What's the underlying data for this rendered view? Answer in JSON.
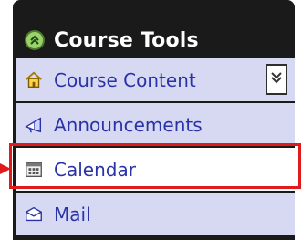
{
  "header": {
    "title": "Course Tools",
    "collapse_icon": "chevron-double-up-icon"
  },
  "menu": {
    "items": [
      {
        "label": "Course Content",
        "icon": "house-icon",
        "has_expand": true
      },
      {
        "label": "Announcements",
        "icon": "megaphone-icon"
      },
      {
        "label": "Calendar",
        "icon": "calendar-icon",
        "selected": true
      },
      {
        "label": "Mail",
        "icon": "mail-icon"
      }
    ]
  },
  "annotation": {
    "highlight_color": "#e11b1b"
  }
}
